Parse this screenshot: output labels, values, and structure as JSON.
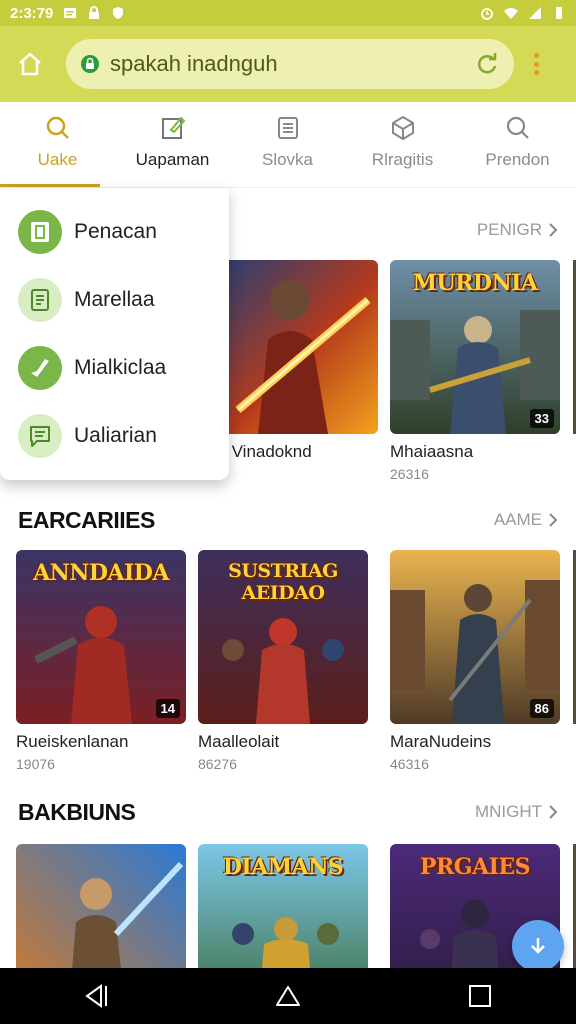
{
  "status_bar": {
    "time": "2:3:79"
  },
  "toolbar": {
    "url": "spakah inadnguh"
  },
  "tabs": [
    {
      "label": "Uake",
      "icon": "search-icon"
    },
    {
      "label": "Uapaman",
      "icon": "edit-icon"
    },
    {
      "label": "Slovka",
      "icon": "list-icon"
    },
    {
      "label": "Rlragitis",
      "icon": "cube-icon"
    },
    {
      "label": "Prendon",
      "icon": "search-icon"
    }
  ],
  "dropdown": {
    "items": [
      {
        "label": "Penacan",
        "icon": "book-icon"
      },
      {
        "label": "Marellaa",
        "icon": "document-icon"
      },
      {
        "label": "Mialkiclaa",
        "icon": "check-icon"
      },
      {
        "label": "Ualiarian",
        "icon": "chat-icon"
      }
    ]
  },
  "sections": [
    {
      "title": "",
      "more": "PENIGR",
      "cards": [
        {
          "title": "na Vinadoknd",
          "sub": "76",
          "thumb_title": "",
          "badge": ""
        },
        {
          "title": "Mhaiaasna",
          "sub": "26316",
          "thumb_title": "MURDNIA",
          "badge": "33"
        }
      ]
    },
    {
      "title": "EARCARIIES",
      "more": "AAME",
      "cards": [
        {
          "title": "Rueiskenlanan",
          "sub": "19076",
          "thumb_title": "ANNDAIDA",
          "badge": "14"
        },
        {
          "title": "Maalleolait",
          "sub": "86276",
          "thumb_title": "SUSTRIAG AEIDAO",
          "badge": ""
        },
        {
          "title": "MaraNudeins",
          "sub": "46316",
          "thumb_title": "",
          "badge": "86"
        }
      ]
    },
    {
      "title": "BAKBIUNS",
      "more": "MNIGHT",
      "cards": [
        {
          "title": "",
          "sub": "",
          "thumb_title": "",
          "badge": ""
        },
        {
          "title": "",
          "sub": "",
          "thumb_title": "DIAMANS",
          "badge": ""
        },
        {
          "title": "",
          "sub": "",
          "thumb_title": "PRGAIES",
          "badge": ""
        }
      ]
    }
  ],
  "colors": {
    "toolbar": "#d4da55",
    "status_bar": "#c6cd3d",
    "active_tab": "#c9a21f",
    "icon_green": "#7ab648",
    "fab": "#5ea4f1"
  }
}
